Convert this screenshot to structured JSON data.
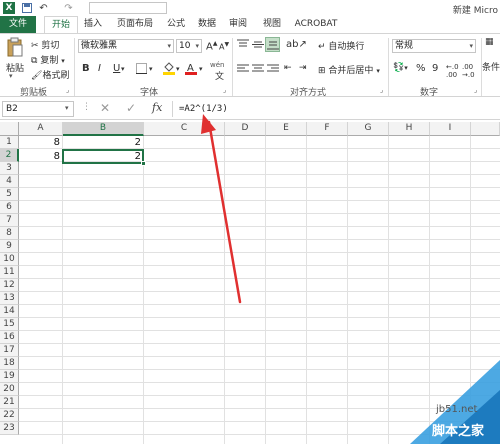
{
  "title_bar": {
    "logo": "X",
    "window_title": "新建 Micro"
  },
  "tabs": [
    "文件",
    "开始",
    "插入",
    "页面布局",
    "公式",
    "数据",
    "审阅",
    "视图",
    "ACROBAT"
  ],
  "ribbon": {
    "clipboard": {
      "paste": "粘贴",
      "cut": "剪切",
      "copy": "复制",
      "format_painter": "格式刷",
      "group_label": "剪贴板"
    },
    "font": {
      "font_name": "微软雅黑",
      "font_size": "10",
      "grow": "A",
      "shrink": "A",
      "bold": "B",
      "italic": "I",
      "underline": "U",
      "wen": "wén",
      "group_label": "字体"
    },
    "alignment": {
      "wrap_text": "自动换行",
      "merge_center": "合并后居中",
      "group_label": "对齐方式"
    },
    "number": {
      "format": "常规",
      "percent": "%",
      "comma": "9",
      "group_label": "数字"
    },
    "styles": {
      "conditional": "条件"
    }
  },
  "formula_bar": {
    "name_box": "B2",
    "fx": "fx",
    "formula": "=A2^(1/3)"
  },
  "sheet": {
    "columns": [
      "A",
      "B",
      "C",
      "D",
      "E",
      "F",
      "G",
      "H",
      "I"
    ],
    "rows": [
      "1",
      "2",
      "3",
      "4",
      "5",
      "6",
      "7",
      "8",
      "9",
      "10",
      "11",
      "12",
      "13",
      "14",
      "15",
      "16",
      "17",
      "18",
      "19",
      "20",
      "21",
      "22",
      "23"
    ],
    "cells": {
      "A1": "8",
      "B1": "2",
      "A2": "8",
      "B2": "2"
    },
    "selected_cell": "B2",
    "selected_column": "B",
    "selected_row": "2"
  },
  "watermark": {
    "site": "jb51.net",
    "name": "脚本之家"
  },
  "colors": {
    "accent": "#217346",
    "arrow": "#e03030"
  }
}
